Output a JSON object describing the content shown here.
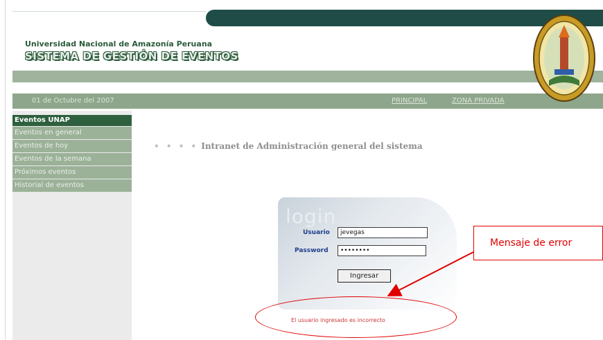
{
  "header": {
    "university": "Universidad Nacional de Amazonía Peruana",
    "system_title": "SISTEMA DE GESTIÓN DE EVENTOS",
    "date": "01 de Octubre del 2007",
    "nav": {
      "principal": "PRINCIPAL",
      "zona_privada": "ZONA PRIVADA"
    }
  },
  "sidebar": {
    "header": "Eventos UNAP",
    "items": [
      {
        "label": "Eventos en general"
      },
      {
        "label": "Eventos de hoy"
      },
      {
        "label": "Eventos de la semana"
      },
      {
        "label": "Próximos eventos"
      },
      {
        "label": "Historial de eventos"
      }
    ]
  },
  "main": {
    "heading_dots": "• • • •",
    "heading": "Intranet de Administración general del sistema"
  },
  "login": {
    "title": "login",
    "user_label": "Usuario",
    "user_value": "jevegas",
    "password_label": "Password",
    "password_value": "••••••••",
    "submit_label": "Ingresar",
    "error_message": "El usuario ingresado es incorrecto"
  },
  "annotation": {
    "callout_text": "Mensaje de error",
    "color": "#e00000"
  },
  "colors": {
    "dark_green": "#1f4c46",
    "menu_green": "#9bb299",
    "menu_header": "#2e5f3e"
  },
  "icons": {
    "seal": "university-seal-icon"
  }
}
